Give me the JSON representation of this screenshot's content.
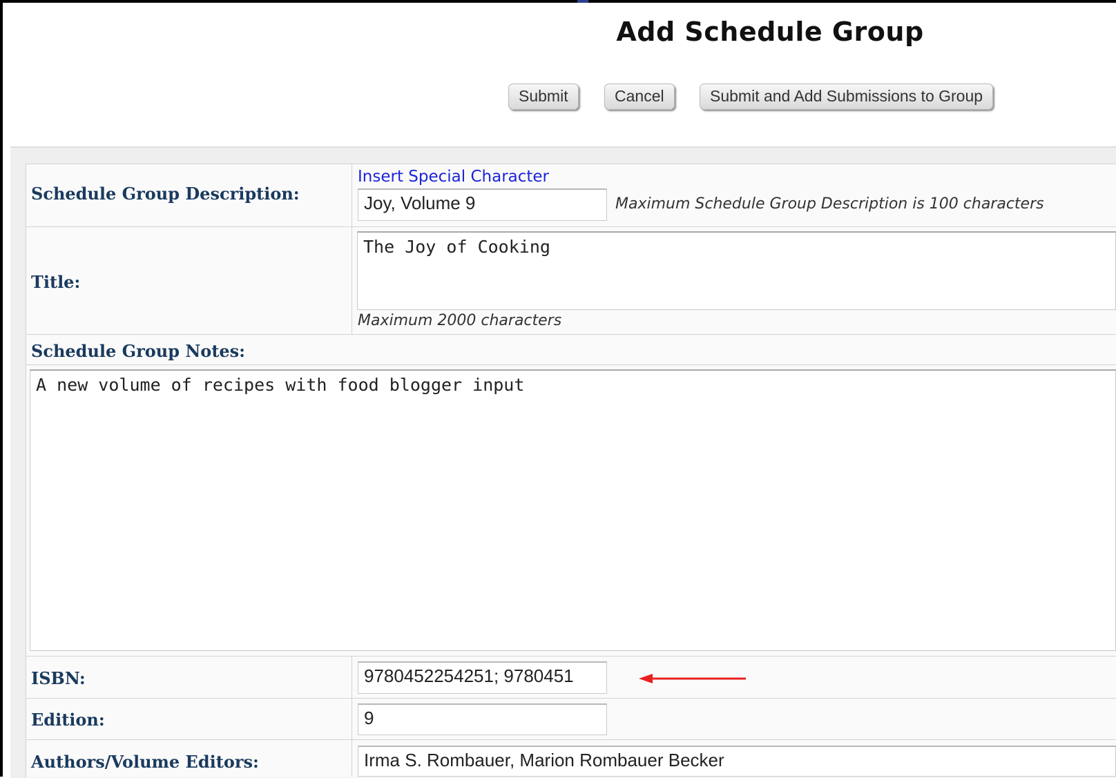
{
  "page": {
    "title": "Add Schedule Group"
  },
  "toolbar": {
    "submit_label": "Submit",
    "cancel_label": "Cancel",
    "submit_add_label": "Submit and Add Submissions to Group"
  },
  "form": {
    "description": {
      "label": "Schedule Group Description:",
      "insert_link": "Insert Special Character",
      "value": "Joy, Volume 9",
      "hint": "Maximum Schedule Group Description is 100 characters"
    },
    "title": {
      "label": "Title:",
      "value": "The Joy of Cooking",
      "hint": "Maximum 2000 characters"
    },
    "notes": {
      "label": "Schedule Group Notes:",
      "value": "A new volume of recipes with food blogger input"
    },
    "isbn": {
      "label": "ISBN:",
      "value": "9780452254251; 9780451"
    },
    "edition": {
      "label": "Edition:",
      "value": "9"
    },
    "authors": {
      "label": "Authors/Volume Editors:",
      "value": "Irma S. Rombauer, Marion Rombauer Becker"
    }
  },
  "annotation": {
    "arrow_color": "#e8201f",
    "arrow_icon": "left-arrow-icon"
  }
}
